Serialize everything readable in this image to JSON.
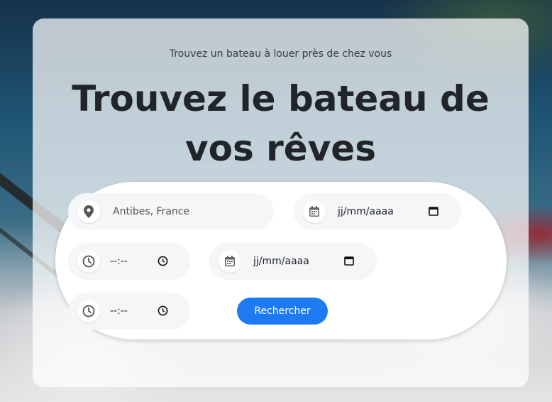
{
  "hero": {
    "subtitle": "Trouvez un bateau à louer près de chez vous",
    "title": "Trouvez le bateau de vos rêves"
  },
  "search": {
    "location": {
      "value": "Antibes, France",
      "icon": "map-pin-icon"
    },
    "start_date": {
      "value": "jj/mm/aaaa",
      "icon": "calendar-icon"
    },
    "start_time": {
      "value": "--:--",
      "icon": "clock-icon"
    },
    "end_date": {
      "value": "jj/mm/aaaa",
      "icon": "calendar-icon"
    },
    "end_time": {
      "value": "--:--",
      "icon": "clock-icon"
    },
    "submit_label": "Rechercher"
  },
  "colors": {
    "accent": "#1d7af3",
    "title": "#212529",
    "field_bg": "#f5f6f8"
  }
}
